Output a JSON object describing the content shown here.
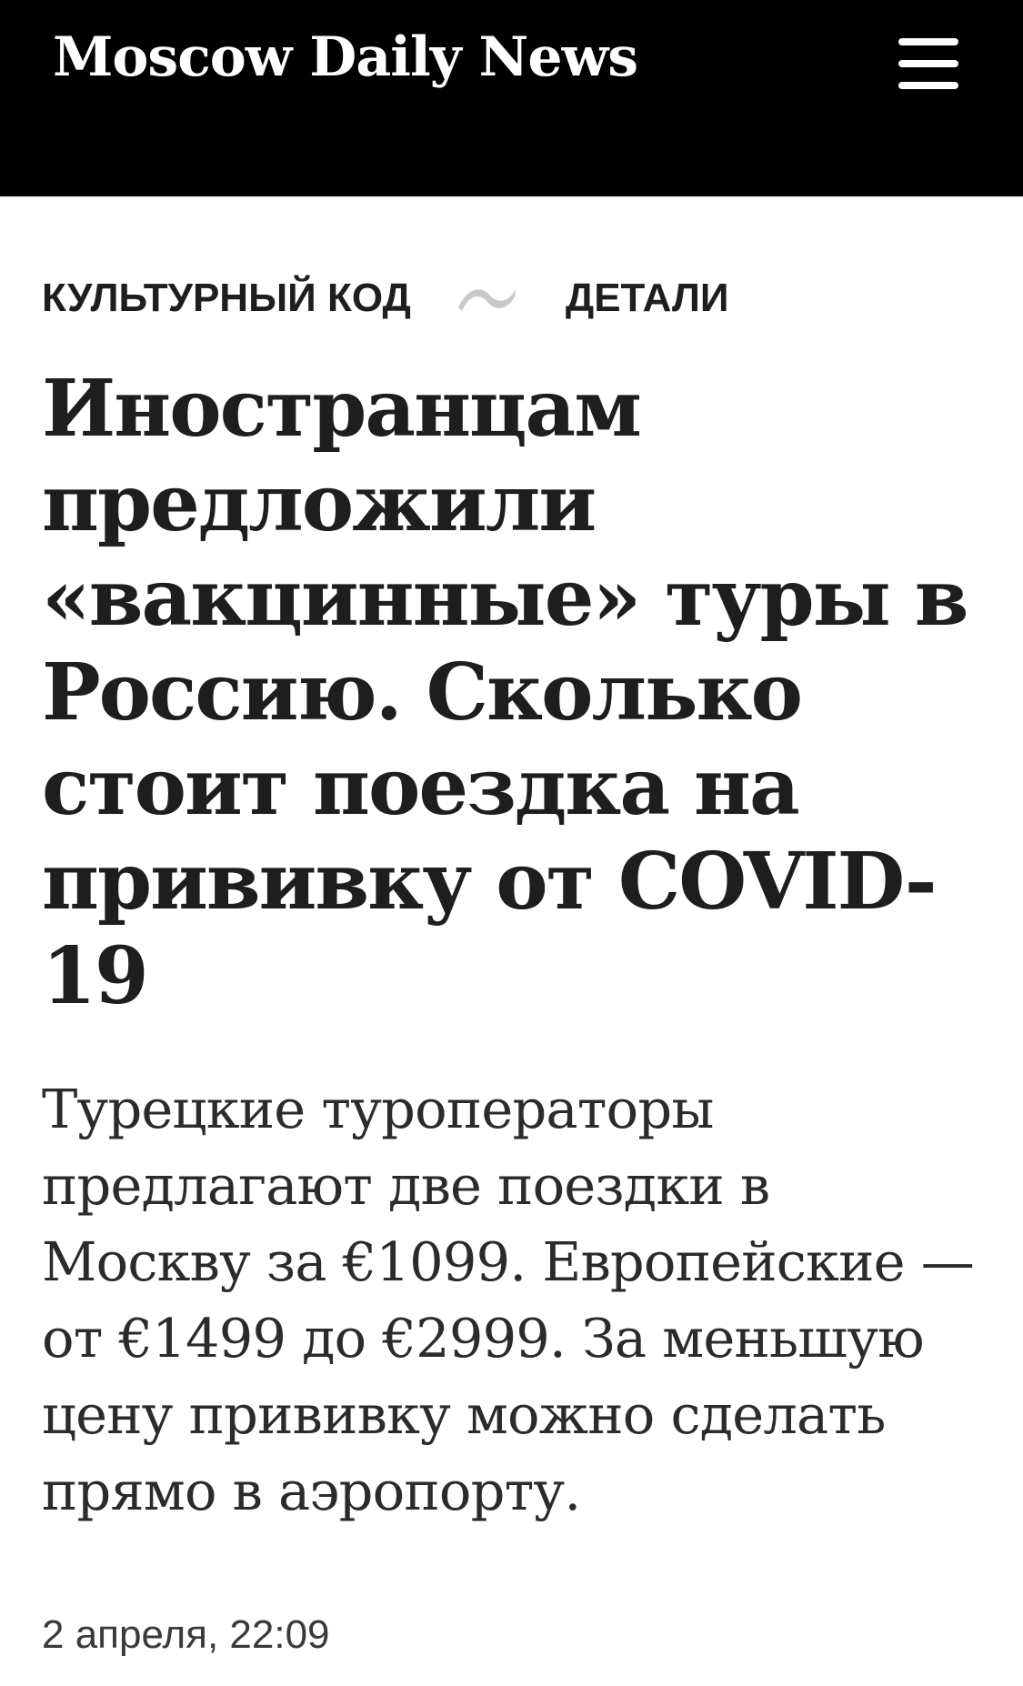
{
  "header": {
    "logo_text": "Moscow Daily News",
    "menu_icon": "hamburger-menu-icon",
    "background": "#000000"
  },
  "breadcrumbs": {
    "section": "КУЛЬТУРНЫЙ КОД",
    "separator_icon": "wave-separator-icon",
    "subsection": "ДЕТАЛИ"
  },
  "article": {
    "headline": "Иностранцам предложили «вакцинные» туры в Россию. Сколько стоит поездка на прививку от COVID-19",
    "lead": "Турецкие туроператоры предлагают две поездки в Москву за €1099. Европейские — от €1499 до €2999. За меньшую цену прививку можно сделать прямо в аэропорту.",
    "date": "2 апреля, 22:09"
  },
  "colors": {
    "text": "#1e1e1e",
    "separator": "#c8c8c8",
    "header_bg": "#000000"
  }
}
